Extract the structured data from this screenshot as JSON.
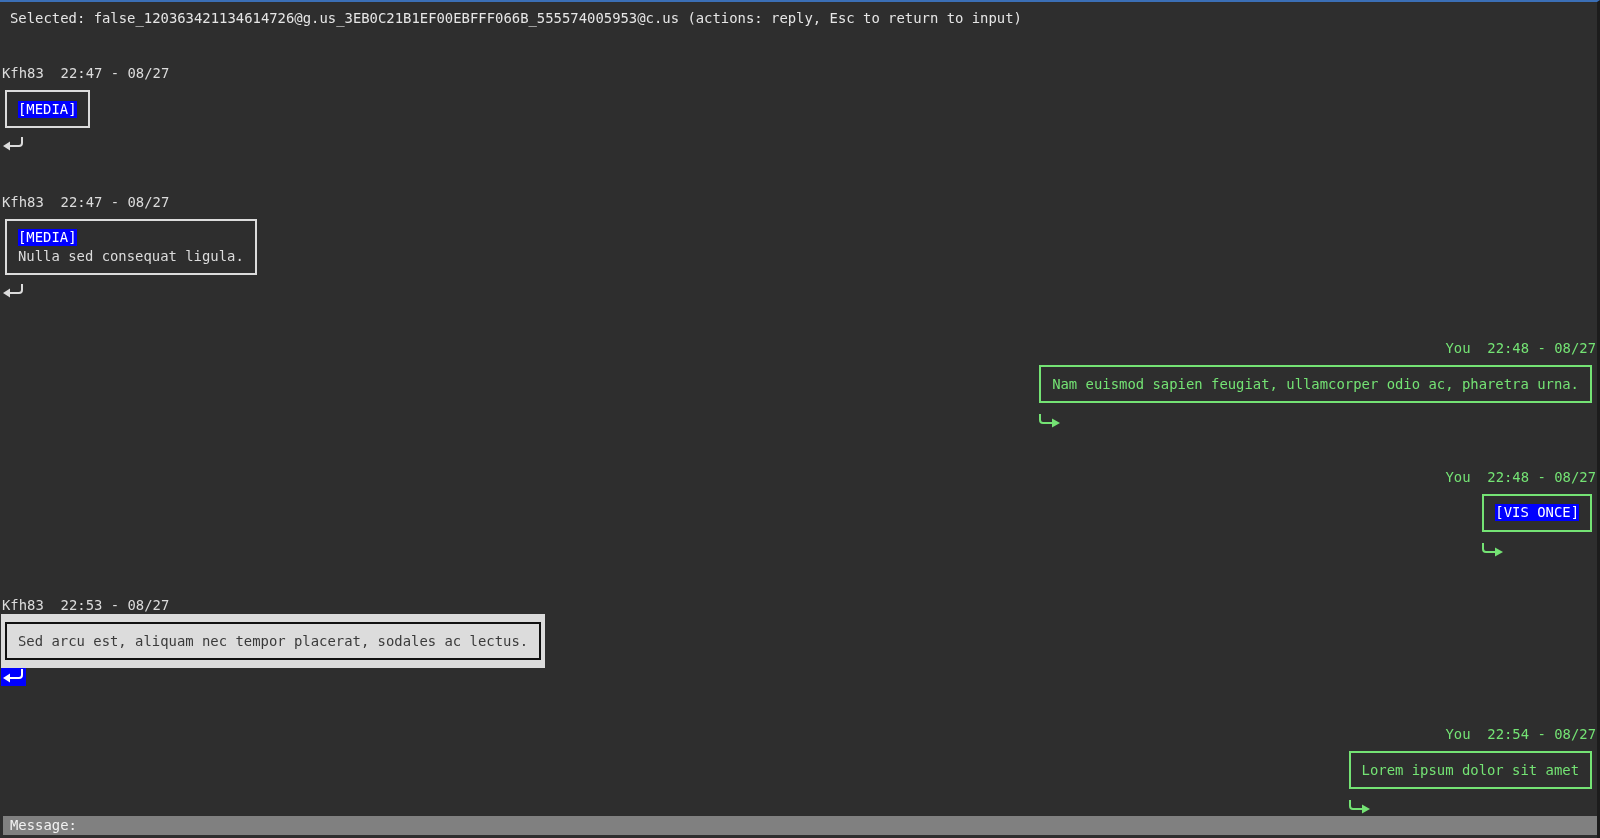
{
  "status_line": "Selected: false_120363421134614726@g.us_3EB0C21B1EF00EBFFF066B_555574005953@c.us (actions: reply, Esc to return to input)",
  "messages": [
    {
      "kind": "incoming",
      "sender": "Kfh83",
      "time": "22:47 - 08/27",
      "selected": false,
      "content": [
        {
          "kind": "tag",
          "text": "[MEDIA]"
        }
      ]
    },
    {
      "kind": "incoming",
      "sender": "Kfh83",
      "time": "22:47 - 08/27",
      "selected": false,
      "content": [
        {
          "kind": "tag",
          "text": "[MEDIA]"
        },
        {
          "kind": "text",
          "text": "Nulla sed consequat ligula."
        }
      ]
    },
    {
      "kind": "outgoing",
      "sender": "You",
      "time": "22:48 - 08/27",
      "selected": false,
      "content": [
        {
          "kind": "text",
          "text": "Nam euismod sapien feugiat, ullamcorper odio ac, pharetra urna."
        }
      ]
    },
    {
      "kind": "outgoing",
      "sender": "You",
      "time": "22:48 - 08/27",
      "selected": false,
      "content": [
        {
          "kind": "tag",
          "text": "[VIS ONCE]"
        }
      ]
    },
    {
      "kind": "incoming",
      "sender": "Kfh83",
      "time": "22:53 - 08/27",
      "selected": true,
      "content": [
        {
          "kind": "text",
          "text": "Sed arcu est, aliquam nec tempor placerat, sodales ac lectus."
        }
      ]
    },
    {
      "kind": "outgoing",
      "sender": "You",
      "time": "22:54 - 08/27",
      "selected": false,
      "content": [
        {
          "kind": "text",
          "text": "Lorem ipsum dolor sit amet"
        }
      ]
    }
  ],
  "input_bar": {
    "label": "Message:"
  }
}
